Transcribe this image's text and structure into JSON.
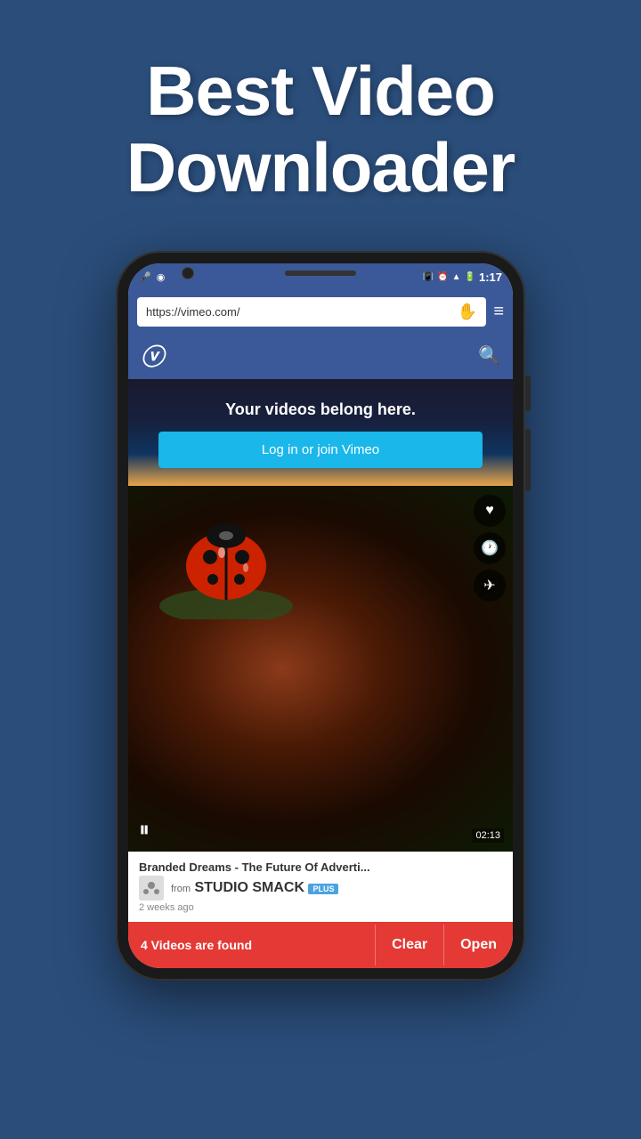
{
  "headline": {
    "line1": "Best Video",
    "line2": "Downloader"
  },
  "phone": {
    "status_bar": {
      "time": "1:17",
      "icons_left": [
        "mic-icon",
        "wifi-icon"
      ],
      "icons_right": [
        "vibrate-icon",
        "alarm-icon",
        "signal-icon",
        "battery-icon"
      ]
    },
    "address_bar": {
      "url": "https://vimeo.com/",
      "menu_label": "≡"
    },
    "vimeo_nav": {
      "logo": "V",
      "search_label": "🔍"
    },
    "hero": {
      "tagline": "Your videos belong here.",
      "cta_button": "Log in or join Vimeo"
    },
    "video": {
      "duration": "02:13",
      "title": "Branded Dreams - The Future Of Adverti...",
      "from_label": "from",
      "studio_name": "STUDIO SMACK",
      "plus_badge": "PLUS",
      "age": "2 weeks ago"
    },
    "bottom_bar": {
      "found_text": "4 Videos are found",
      "clear_label": "Clear",
      "open_label": "Open"
    }
  }
}
